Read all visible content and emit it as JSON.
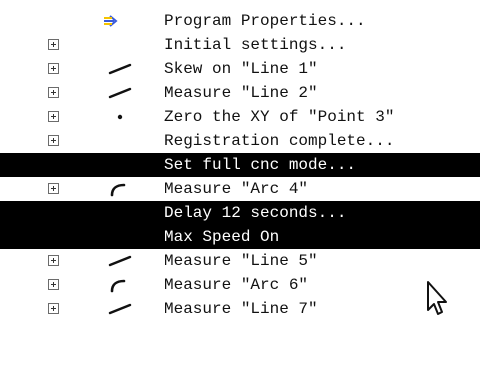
{
  "tree": {
    "rows": [
      {
        "label": "Program Properties...",
        "icon": "program-properties-arrow-icon",
        "expandable": false,
        "selected": false
      },
      {
        "label": "Initial settings...",
        "icon": "",
        "expandable": true,
        "selected": false
      },
      {
        "label": "Skew on \"Line 1\"",
        "icon": "line-icon",
        "expandable": true,
        "selected": false
      },
      {
        "label": "Measure \"Line 2\"",
        "icon": "line-icon",
        "expandable": true,
        "selected": false
      },
      {
        "label": "Zero the XY of \"Point 3\"",
        "icon": "point-icon",
        "expandable": true,
        "selected": false
      },
      {
        "label": "Registration complete...",
        "icon": "",
        "expandable": true,
        "selected": false
      },
      {
        "label": "Set full cnc mode...",
        "icon": "",
        "expandable": false,
        "selected": true
      },
      {
        "label": "Measure \"Arc 4\"",
        "icon": "arc-icon",
        "expandable": true,
        "selected": false
      },
      {
        "label": "Delay 12 seconds...",
        "icon": "",
        "expandable": false,
        "selected": true
      },
      {
        "label": "Max Speed On",
        "icon": "",
        "expandable": false,
        "selected": true
      },
      {
        "label": "Measure \"Line 5\"",
        "icon": "line-icon",
        "expandable": true,
        "selected": false
      },
      {
        "label": "Measure \"Arc 6\"",
        "icon": "arc-icon",
        "expandable": true,
        "selected": false
      },
      {
        "label": "Measure \"Line 7\"",
        "icon": "line-icon",
        "expandable": true,
        "selected": false
      }
    ]
  },
  "colors": {
    "selected_bg": "#000000",
    "selected_text": "#ffffff",
    "text": "#111111",
    "arrow_yellow": "#f5c400",
    "arrow_blue": "#3a5bd9"
  }
}
